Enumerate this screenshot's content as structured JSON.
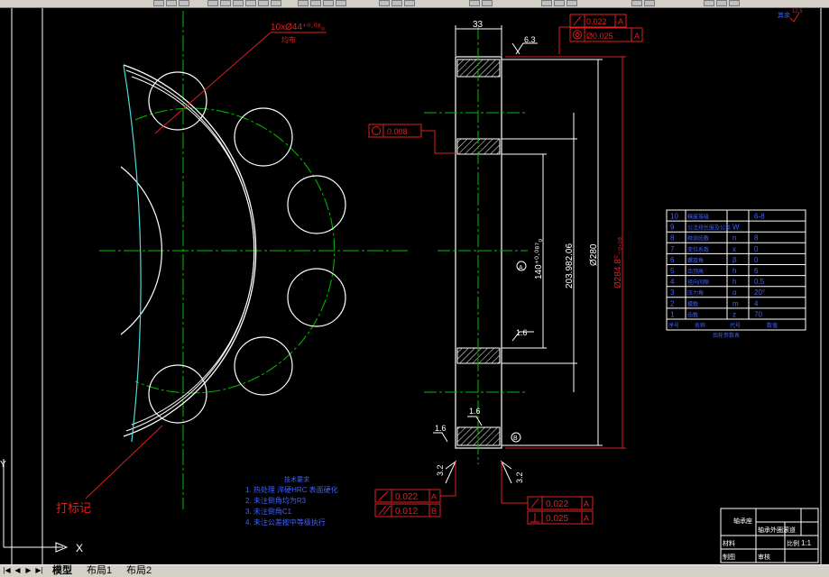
{
  "statusbar": {
    "tabs": [
      "模型",
      "布局1",
      "布局2"
    ]
  },
  "drawing": {
    "hole_spec": "10xØ44⁺⁰·⁰⁸₀",
    "hole_note": "均布",
    "mark_label": "打标记",
    "dim_top_width": "33",
    "roughness_top": "6.3",
    "roughness_bot_left": "3.2",
    "roughness_bot_right": "3.2",
    "roughness_mid": "1.6",
    "roughness_left_low": "1.6",
    "roughness_bottom_mid": "1.6",
    "fcf_top_1": "0.022",
    "fcf_top_1_datum": "A",
    "fcf_top_2": "Ø0.025",
    "fcf_top_2_datum": "A",
    "fcf_round": "0.008",
    "dim_140": "140⁺⁰·⁰⁸⁷₀",
    "dim_203": "203.982.06",
    "dim_280": "Ø280",
    "dim_284": "Ø284.8⁰₋₀.₀₈",
    "datum_a": "A",
    "datum_b": "B",
    "fcf_bl_1": "0.022",
    "fcf_bl_1_datum": "A",
    "fcf_bl_2": "0.012",
    "fcf_bl_2_datum": "B",
    "fcf_br_1": "0.022",
    "fcf_br_1_datum": "A",
    "fcf_br_2": "0.025",
    "fcf_br_2_datum": "A",
    "notes_title": "技术要求",
    "notes": [
      "1. 热处理 淬硬HRC 表面硬化",
      "2. 未注倒角均为R3",
      "3. 未注倒角C1",
      "4. 未注公差按中等级执行"
    ],
    "corner_mark": "其余",
    "corner_roughness": "12.5"
  },
  "param_table": {
    "rows": [
      {
        "no": "10",
        "name": "精度等级",
        "sym": "",
        "val": "6-8"
      },
      {
        "no": "9",
        "name": "公法线长度及公差",
        "sym": "W",
        "val": ""
      },
      {
        "no": "8",
        "name": "跨测齿数",
        "sym": "n",
        "val": "8"
      },
      {
        "no": "7",
        "name": "变位系数",
        "sym": "x",
        "val": "0"
      },
      {
        "no": "6",
        "name": "螺旋角",
        "sym": "β",
        "val": "0"
      },
      {
        "no": "5",
        "name": "齿顶高",
        "sym": "h",
        "val": "6"
      },
      {
        "no": "4",
        "name": "径向间隙",
        "sym": "h",
        "val": "0.5"
      },
      {
        "no": "3",
        "name": "压力角",
        "sym": "α",
        "val": "20°"
      },
      {
        "no": "2",
        "name": "模数",
        "sym": "m",
        "val": "4"
      },
      {
        "no": "1",
        "name": "齿数",
        "sym": "z",
        "val": "70"
      }
    ],
    "header_no": "序号",
    "header_name": "名称",
    "header_sym": "代号",
    "header_val": "数值",
    "footer": "齿轮参数表"
  },
  "title_block": {
    "r1": "轴承座",
    "r2": "比例",
    "r3": "材料",
    "r4": "轴承外圈滚道",
    "scale": "1:1",
    "r6": "制图",
    "r7": "审核"
  },
  "ucs": {
    "x": "X",
    "y": "Y"
  }
}
